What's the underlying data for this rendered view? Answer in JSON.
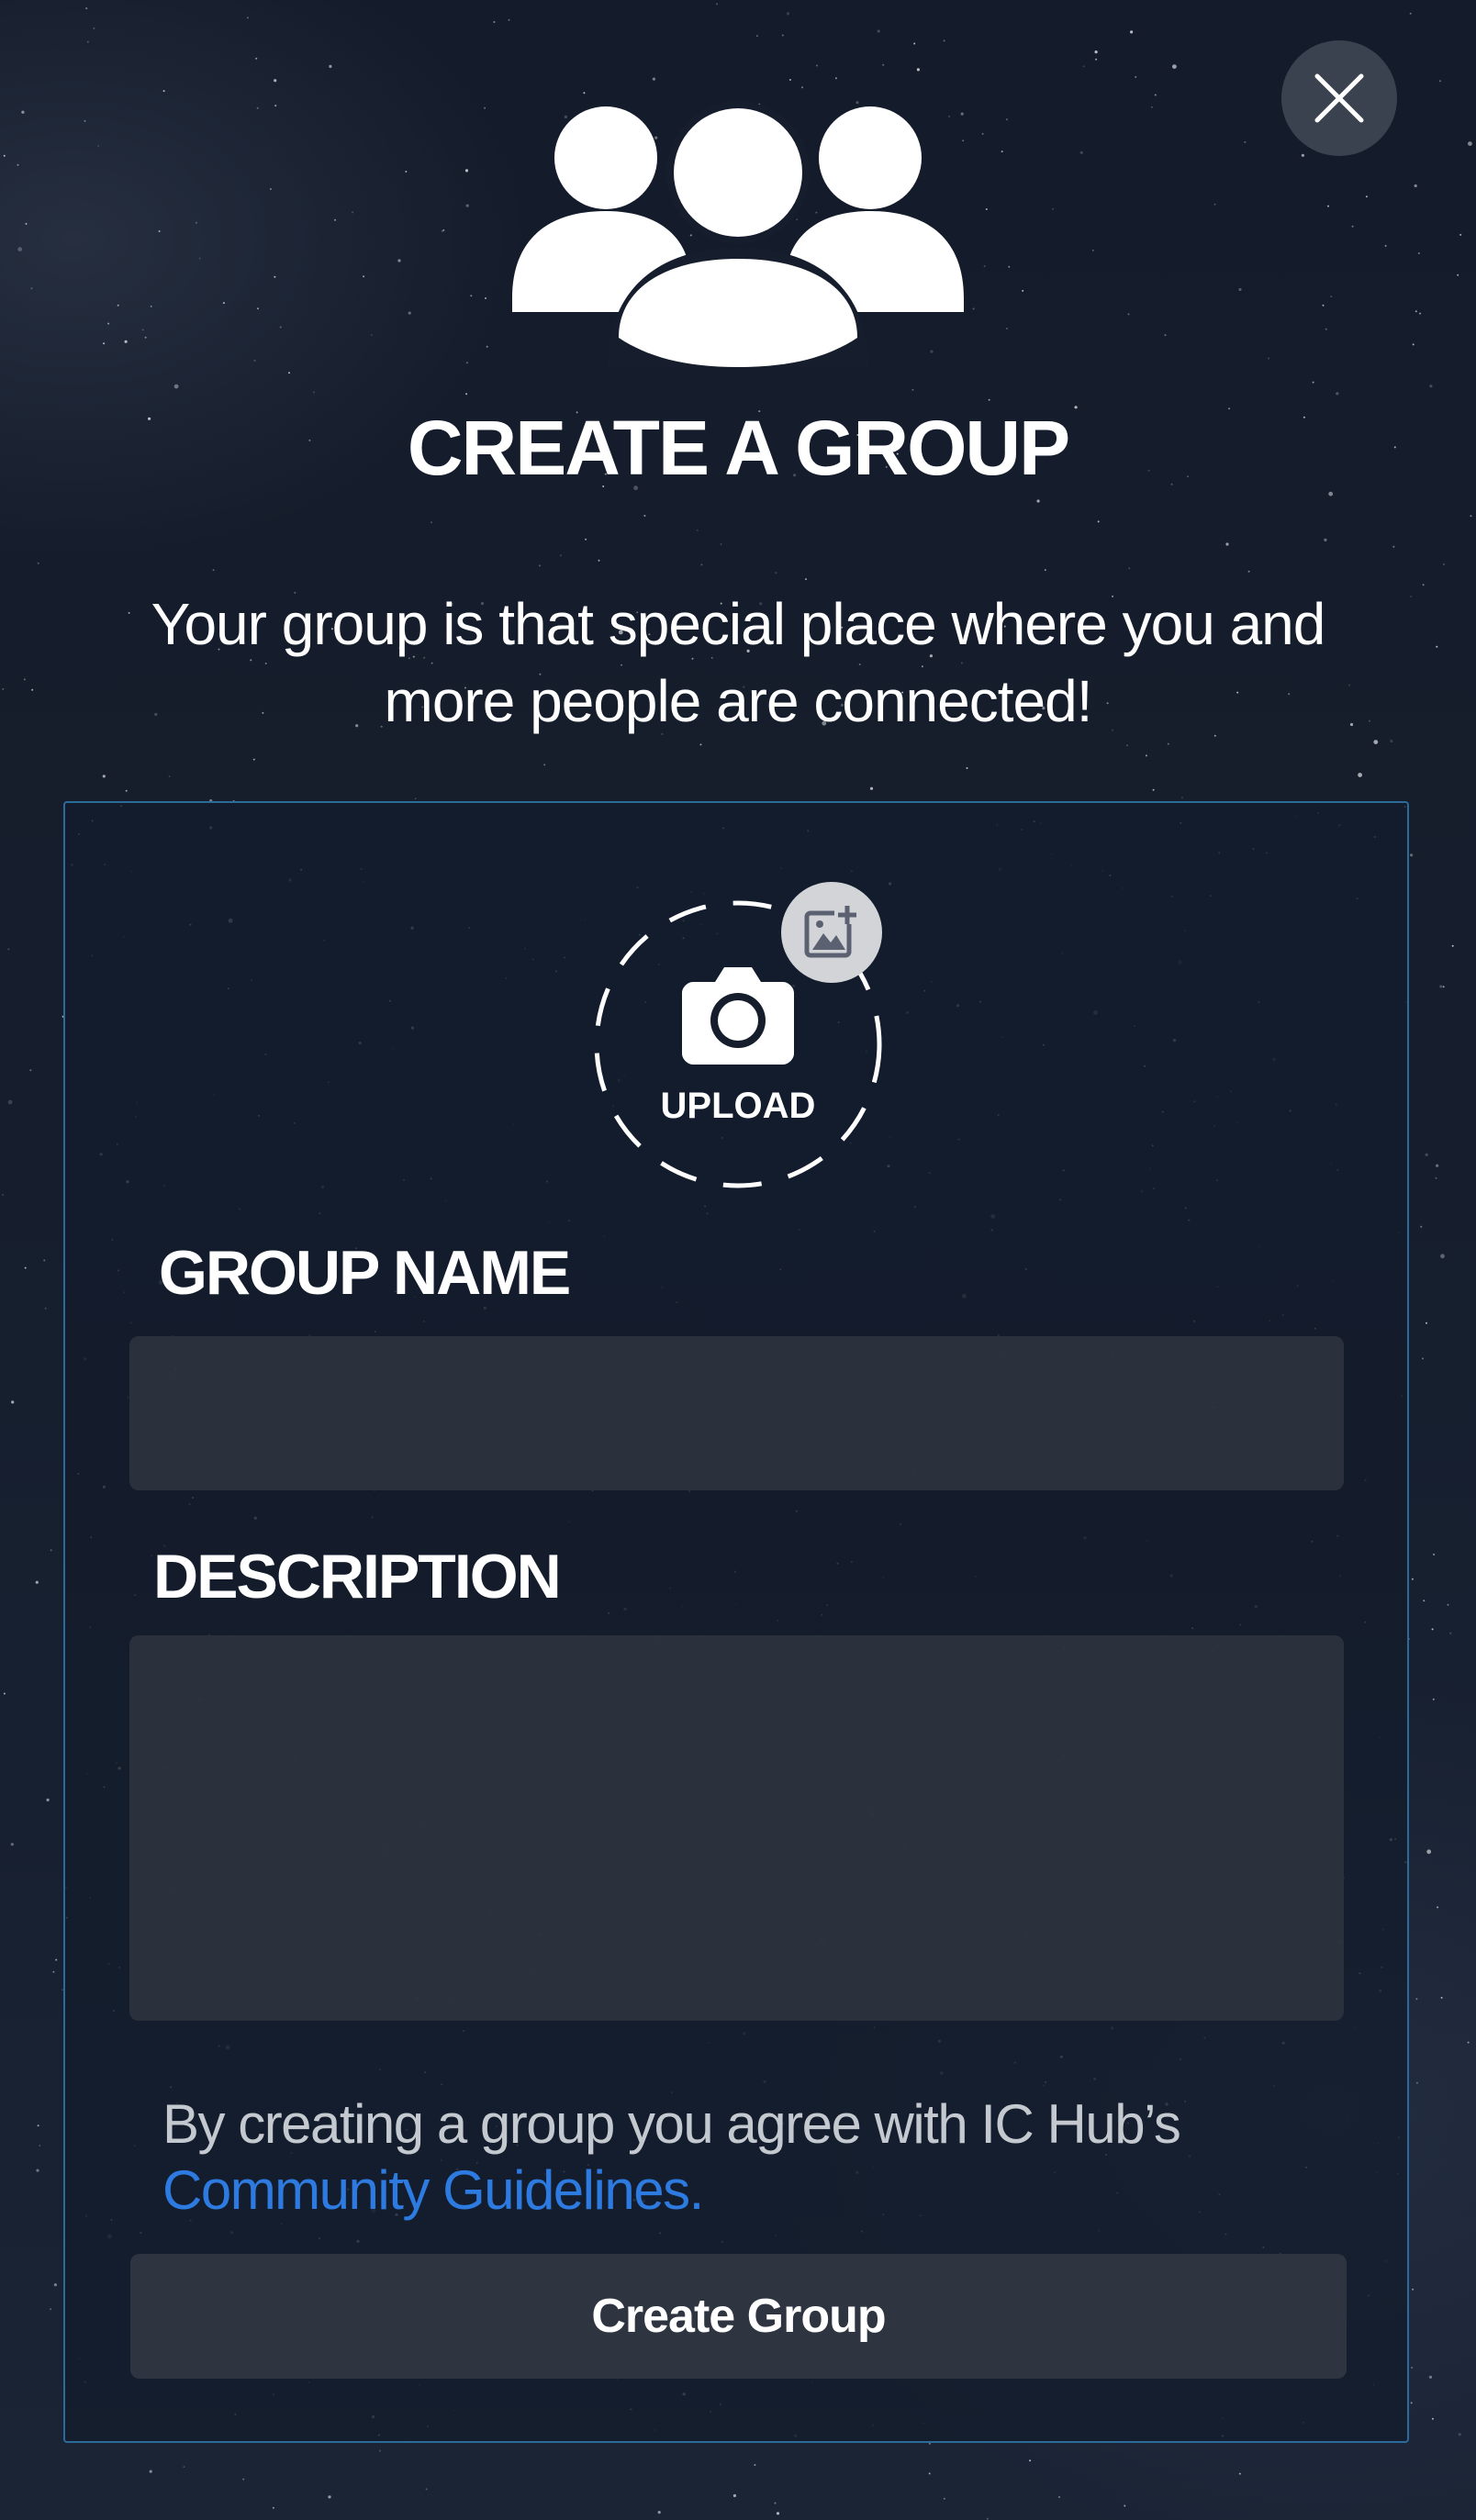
{
  "header": {
    "close_icon": "close-icon",
    "group_icon": "group-icon",
    "title": "CREATE A GROUP",
    "intro": "Your group is that special place where you and more people are connected!"
  },
  "form": {
    "upload": {
      "label": "UPLOAD",
      "camera_icon": "camera-icon",
      "add_image_icon": "add-image-icon"
    },
    "group_name": {
      "label": "GROUP NAME",
      "value": ""
    },
    "description": {
      "label": "DESCRIPTION",
      "value": ""
    },
    "agreement_text": "By creating a group you agree with IC Hub’s",
    "agreement_link": "Community Guidelines.",
    "submit_label": "Create Group"
  },
  "colors": {
    "background": "#161e2d",
    "card_border": "#2b6a99",
    "input_background": "#2d333e",
    "link": "#2d7be0",
    "button_background": "#2f3540"
  }
}
